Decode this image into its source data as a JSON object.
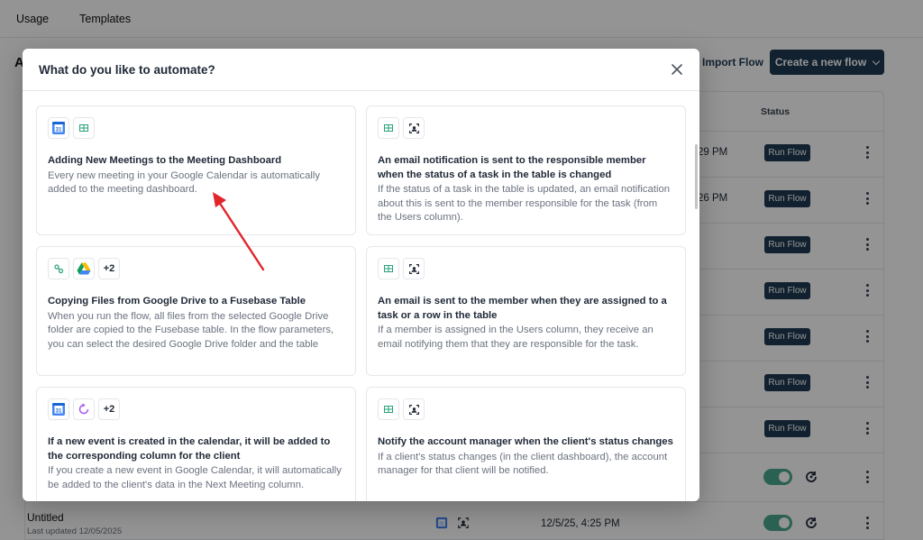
{
  "nav": {
    "tabs": [
      "Usage",
      "Templates"
    ]
  },
  "page": {
    "title_initial": "A"
  },
  "toolbar": {
    "import_label": "Import Flow",
    "create_label": "Create a new flow"
  },
  "table": {
    "status_header": "Status",
    "rows": [
      {
        "time": "29 PM",
        "action": "Run Flow"
      },
      {
        "time": "26 PM",
        "action": "Run Flow"
      },
      {
        "action": "Run Flow"
      },
      {
        "action": "Run Flow"
      },
      {
        "action": "Run Flow"
      },
      {
        "action": "Run Flow"
      },
      {
        "action": "Run Flow"
      }
    ],
    "last_row": {
      "name": "Untitled",
      "updated": "Last updated 12/05/2025",
      "date": "12/5/25, 4:25 PM"
    }
  },
  "modal": {
    "title": "What do you like to automate?",
    "cards": [
      {
        "icons": [
          "google-calendar-icon",
          "fusebase-table-icon"
        ],
        "title": "Adding New Meetings to the Meeting Dashboard",
        "description": "Every new meeting in your Google Calendar is automatically added to the meeting dashboard."
      },
      {
        "icons": [
          "fusebase-table-icon",
          "focus-user-icon"
        ],
        "title": "An email notification is sent to the responsible member when the status of a task in the table is changed",
        "description": "If the status of a task in the table is updated, an email notification about this is sent to the member responsible for the task (from the Users column)."
      },
      {
        "icons": [
          "webhook-icon",
          "google-drive-icon"
        ],
        "extra": "+2",
        "title": "Copying Files from Google Drive to a Fusebase Table",
        "description": "When you run the flow, all files from the selected Google Drive folder are copied to the Fusebase table. In the flow parameters, you can select the desired Google Drive folder and the table"
      },
      {
        "icons": [
          "fusebase-table-icon",
          "focus-user-icon"
        ],
        "title": "An email is sent to the member when they are assigned to a task or a row in the table",
        "description": "If a member is assigned in the Users column, they receive an email notifying them that they are responsible for the task."
      },
      {
        "icons": [
          "google-calendar-icon",
          "sync-icon"
        ],
        "extra": "+2",
        "title": "If a new event is created in the calendar, it will be added to the corresponding column for the client",
        "description": "If you create a new event in Google Calendar, it will automatically be added to the client's data in the Next Meeting column."
      },
      {
        "icons": [
          "fusebase-table-icon",
          "focus-user-icon"
        ],
        "title": "Notify the account manager when the client's status changes",
        "description": "If a client's status changes (in the client dashboard), the account manager for that client will be notified."
      }
    ]
  },
  "colors": {
    "primary": "#1e3a52",
    "toggle": "#4aa78e",
    "arrow": "#e0262b"
  }
}
